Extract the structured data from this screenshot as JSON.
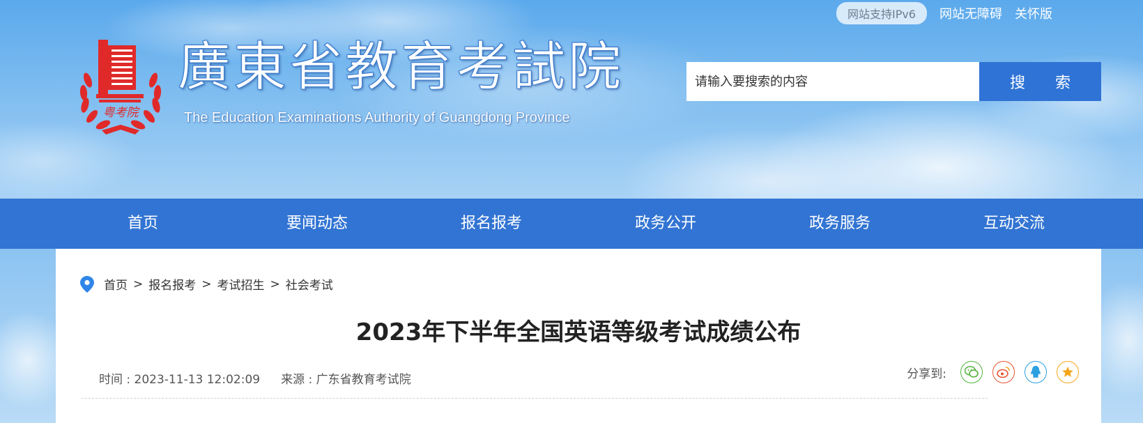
{
  "top_links": {
    "ipv6": "网站支持IPv6",
    "accessibility": "网站无障碍",
    "care": "关怀版"
  },
  "logo": {
    "cn_name": "廣東省教育考試院",
    "en_name": "The Education Examinations Authority of Guangdong Province",
    "emblem_text": "粤考院"
  },
  "search": {
    "placeholder": "请输入要搜索的内容",
    "button_label": "搜 索"
  },
  "nav": {
    "items": [
      "首页",
      "要闻动态",
      "报名报考",
      "政务公开",
      "政务服务",
      "互动交流"
    ]
  },
  "breadcrumb": {
    "items": [
      "首页",
      "报名报考",
      "考试招生",
      "社会考试"
    ],
    "separator": ">"
  },
  "article": {
    "title": "2023年下半年全国英语等级考试成绩公布",
    "time_label": "时间 : 2023-11-13 12:02:09",
    "source_label": "来源 : 广东省教育考试院"
  },
  "share": {
    "label": "分享到:",
    "icons": [
      "wechat-icon",
      "weibo-icon",
      "qq-icon",
      "qzone-icon"
    ]
  },
  "colors": {
    "nav_bg": "#3274d3",
    "search_button": "#2f73d6",
    "emblem_red": "#e02a2a",
    "wechat": "#52b23c",
    "weibo": "#e8542f",
    "qq": "#2da0e0",
    "qzone": "#f3a51c"
  }
}
